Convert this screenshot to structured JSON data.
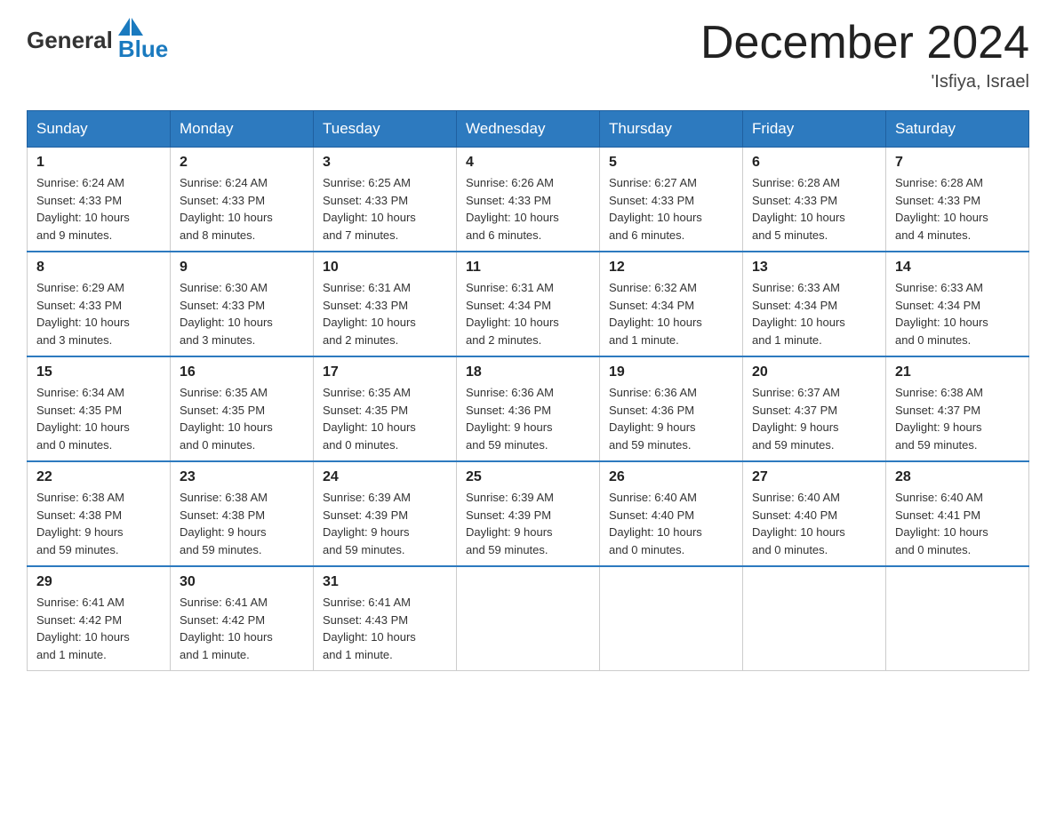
{
  "header": {
    "logo": {
      "text_general": "General",
      "text_blue": "Blue"
    },
    "title": "December 2024",
    "location": "'Isfiya, Israel"
  },
  "days_of_week": [
    "Sunday",
    "Monday",
    "Tuesday",
    "Wednesday",
    "Thursday",
    "Friday",
    "Saturday"
  ],
  "weeks": [
    [
      {
        "day": "1",
        "sunrise": "6:24 AM",
        "sunset": "4:33 PM",
        "daylight": "10 hours and 9 minutes."
      },
      {
        "day": "2",
        "sunrise": "6:24 AM",
        "sunset": "4:33 PM",
        "daylight": "10 hours and 8 minutes."
      },
      {
        "day": "3",
        "sunrise": "6:25 AM",
        "sunset": "4:33 PM",
        "daylight": "10 hours and 7 minutes."
      },
      {
        "day": "4",
        "sunrise": "6:26 AM",
        "sunset": "4:33 PM",
        "daylight": "10 hours and 6 minutes."
      },
      {
        "day": "5",
        "sunrise": "6:27 AM",
        "sunset": "4:33 PM",
        "daylight": "10 hours and 6 minutes."
      },
      {
        "day": "6",
        "sunrise": "6:28 AM",
        "sunset": "4:33 PM",
        "daylight": "10 hours and 5 minutes."
      },
      {
        "day": "7",
        "sunrise": "6:28 AM",
        "sunset": "4:33 PM",
        "daylight": "10 hours and 4 minutes."
      }
    ],
    [
      {
        "day": "8",
        "sunrise": "6:29 AM",
        "sunset": "4:33 PM",
        "daylight": "10 hours and 3 minutes."
      },
      {
        "day": "9",
        "sunrise": "6:30 AM",
        "sunset": "4:33 PM",
        "daylight": "10 hours and 3 minutes."
      },
      {
        "day": "10",
        "sunrise": "6:31 AM",
        "sunset": "4:33 PM",
        "daylight": "10 hours and 2 minutes."
      },
      {
        "day": "11",
        "sunrise": "6:31 AM",
        "sunset": "4:34 PM",
        "daylight": "10 hours and 2 minutes."
      },
      {
        "day": "12",
        "sunrise": "6:32 AM",
        "sunset": "4:34 PM",
        "daylight": "10 hours and 1 minute."
      },
      {
        "day": "13",
        "sunrise": "6:33 AM",
        "sunset": "4:34 PM",
        "daylight": "10 hours and 1 minute."
      },
      {
        "day": "14",
        "sunrise": "6:33 AM",
        "sunset": "4:34 PM",
        "daylight": "10 hours and 0 minutes."
      }
    ],
    [
      {
        "day": "15",
        "sunrise": "6:34 AM",
        "sunset": "4:35 PM",
        "daylight": "10 hours and 0 minutes."
      },
      {
        "day": "16",
        "sunrise": "6:35 AM",
        "sunset": "4:35 PM",
        "daylight": "10 hours and 0 minutes."
      },
      {
        "day": "17",
        "sunrise": "6:35 AM",
        "sunset": "4:35 PM",
        "daylight": "10 hours and 0 minutes."
      },
      {
        "day": "18",
        "sunrise": "6:36 AM",
        "sunset": "4:36 PM",
        "daylight": "9 hours and 59 minutes."
      },
      {
        "day": "19",
        "sunrise": "6:36 AM",
        "sunset": "4:36 PM",
        "daylight": "9 hours and 59 minutes."
      },
      {
        "day": "20",
        "sunrise": "6:37 AM",
        "sunset": "4:37 PM",
        "daylight": "9 hours and 59 minutes."
      },
      {
        "day": "21",
        "sunrise": "6:38 AM",
        "sunset": "4:37 PM",
        "daylight": "9 hours and 59 minutes."
      }
    ],
    [
      {
        "day": "22",
        "sunrise": "6:38 AM",
        "sunset": "4:38 PM",
        "daylight": "9 hours and 59 minutes."
      },
      {
        "day": "23",
        "sunrise": "6:38 AM",
        "sunset": "4:38 PM",
        "daylight": "9 hours and 59 minutes."
      },
      {
        "day": "24",
        "sunrise": "6:39 AM",
        "sunset": "4:39 PM",
        "daylight": "9 hours and 59 minutes."
      },
      {
        "day": "25",
        "sunrise": "6:39 AM",
        "sunset": "4:39 PM",
        "daylight": "9 hours and 59 minutes."
      },
      {
        "day": "26",
        "sunrise": "6:40 AM",
        "sunset": "4:40 PM",
        "daylight": "10 hours and 0 minutes."
      },
      {
        "day": "27",
        "sunrise": "6:40 AM",
        "sunset": "4:40 PM",
        "daylight": "10 hours and 0 minutes."
      },
      {
        "day": "28",
        "sunrise": "6:40 AM",
        "sunset": "4:41 PM",
        "daylight": "10 hours and 0 minutes."
      }
    ],
    [
      {
        "day": "29",
        "sunrise": "6:41 AM",
        "sunset": "4:42 PM",
        "daylight": "10 hours and 1 minute."
      },
      {
        "day": "30",
        "sunrise": "6:41 AM",
        "sunset": "4:42 PM",
        "daylight": "10 hours and 1 minute."
      },
      {
        "day": "31",
        "sunrise": "6:41 AM",
        "sunset": "4:43 PM",
        "daylight": "10 hours and 1 minute."
      },
      null,
      null,
      null,
      null
    ]
  ]
}
